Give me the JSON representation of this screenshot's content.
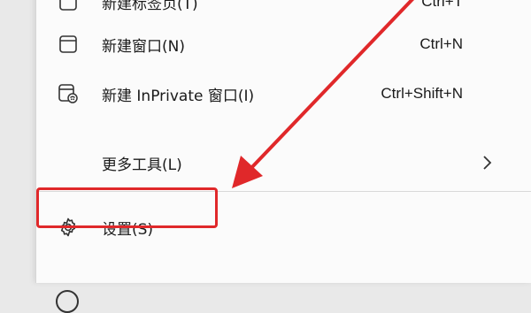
{
  "menu": {
    "top_cut": {
      "label": "新建标签页(T)",
      "shortcut": "Ctrl+T",
      "icon": "new-tab-icon"
    },
    "new_window": {
      "label": "新建窗口(N)",
      "shortcut": "Ctrl+N",
      "icon": "window-icon"
    },
    "new_inprivate": {
      "label": "新建 InPrivate 窗口(I)",
      "shortcut": "Ctrl+Shift+N",
      "icon": "inprivate-window-icon"
    },
    "more_tools": {
      "label": "更多工具(L)",
      "icon": "chevron-right-icon"
    },
    "settings": {
      "label": "设置(S)",
      "icon": "gear-icon"
    }
  },
  "annotation": {
    "color": "#e0282a"
  }
}
